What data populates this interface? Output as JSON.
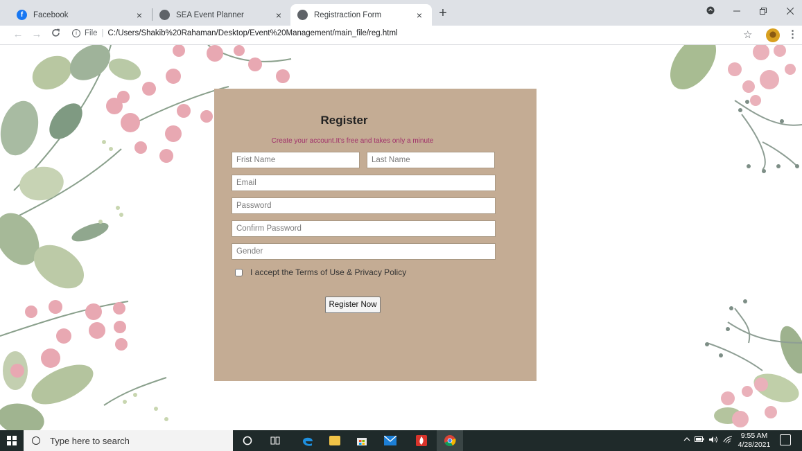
{
  "browser": {
    "tabs": [
      {
        "title": "Facebook",
        "favicon": "facebook-icon",
        "active": false,
        "close": "×"
      },
      {
        "title": "SEA Event Planner",
        "favicon": "globe-icon",
        "active": false,
        "close": "×"
      },
      {
        "title": "Registraction Form",
        "favicon": "globe-icon",
        "active": true,
        "close": "×"
      }
    ],
    "new_tab": "+",
    "address": {
      "info_glyph": "i",
      "scheme_label": "File",
      "separator": "|",
      "url": "C:/Users/Shakib%20Rahaman/Desktop/Event%20Management/main_file/reg.html"
    }
  },
  "form": {
    "title": "Register",
    "subtitle": "Create your account.It's free and takes only a minute",
    "first_name_placeholder": "Frist Name",
    "last_name_placeholder": "Last Name",
    "email_placeholder": "Email",
    "password_placeholder": "Password",
    "confirm_password_placeholder": "Confirm Password",
    "gender_placeholder": "Gender",
    "terms_label": "I accept the Terms of Use & Privacy Policy",
    "terms_checked": false,
    "submit_label": "Register Now"
  },
  "taskbar": {
    "search_placeholder": "Type here to search",
    "time": "9:55 AM",
    "date": "4/28/2021"
  },
  "colors": {
    "card_background": "#c4ac94",
    "subtitle_color": "#a0306a",
    "taskbar": "#1f2a2a"
  }
}
